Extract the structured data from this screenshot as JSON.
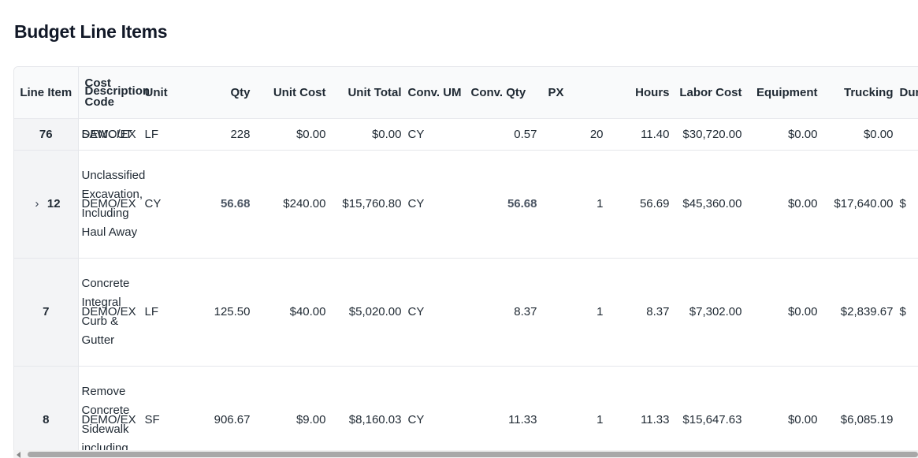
{
  "page": {
    "title": "Budget Line Items"
  },
  "columns": {
    "line_item": "Line Item",
    "cost_code_a": "Cost",
    "cost_code_b": "Code",
    "description": "Description",
    "unit": "Unit",
    "qty": "Qty",
    "unit_cost": "Unit Cost",
    "unit_total": "Unit Total",
    "conv_um": "Conv. UM",
    "conv_qty": "Conv. Qty",
    "px": "PX",
    "hours": "Hours",
    "labor_cost": "Labor Cost",
    "equipment": "Equipment",
    "trucking": "Trucking",
    "dur": "Dur"
  },
  "rows": [
    {
      "line_item": "76",
      "cost_code": "DEMO/EX",
      "description": "SAWCUT",
      "unit": "LF",
      "qty": "228",
      "unit_cost": "$0.00",
      "unit_total": "$0.00",
      "conv_um": "CY",
      "conv_qty": "0.57",
      "px": "20",
      "hours": "11.40",
      "labor_cost": "$30,720.00",
      "equipment": "$0.00",
      "trucking": "$0.00",
      "dur": "",
      "expandable": false
    },
    {
      "line_item": "12",
      "cost_code": "DEMO/EX",
      "description": "Unclassified Excavation, Including Haul Away",
      "unit": "CY",
      "qty": "56.68",
      "unit_cost": "$240.00",
      "unit_total": "$15,760.80",
      "conv_um": "CY",
      "conv_qty": "56.68",
      "px": "1",
      "hours": "56.69",
      "labor_cost": "$45,360.00",
      "equipment": "$0.00",
      "trucking": "$17,640.00",
      "dur": "$",
      "expandable": true
    },
    {
      "line_item": "7",
      "cost_code": "DEMO/EX",
      "description": "Concrete Integral Curb & Gutter",
      "unit": "LF",
      "qty": "125.50",
      "unit_cost": "$40.00",
      "unit_total": "$5,020.00",
      "conv_um": "CY",
      "conv_qty": "8.37",
      "px": "1",
      "hours": "8.37",
      "labor_cost": "$7,302.00",
      "equipment": "$0.00",
      "trucking": "$2,839.67",
      "dur": "$",
      "expandable": false
    },
    {
      "line_item": "8",
      "cost_code": "DEMO/EX",
      "description": "Remove Concrete Sidewalk including",
      "unit": "SF",
      "qty": "906.67",
      "unit_cost": "$9.00",
      "unit_total": "$8,160.03",
      "conv_um": "CY",
      "conv_qty": "11.33",
      "px": "1",
      "hours": "11.33",
      "labor_cost": "$15,647.63",
      "equipment": "$0.00",
      "trucking": "$6,085.19",
      "dur": "",
      "expandable": false
    }
  ],
  "icons": {
    "expand": "chevron-right-icon",
    "scroll_left": "scroll-left-arrow-icon"
  }
}
